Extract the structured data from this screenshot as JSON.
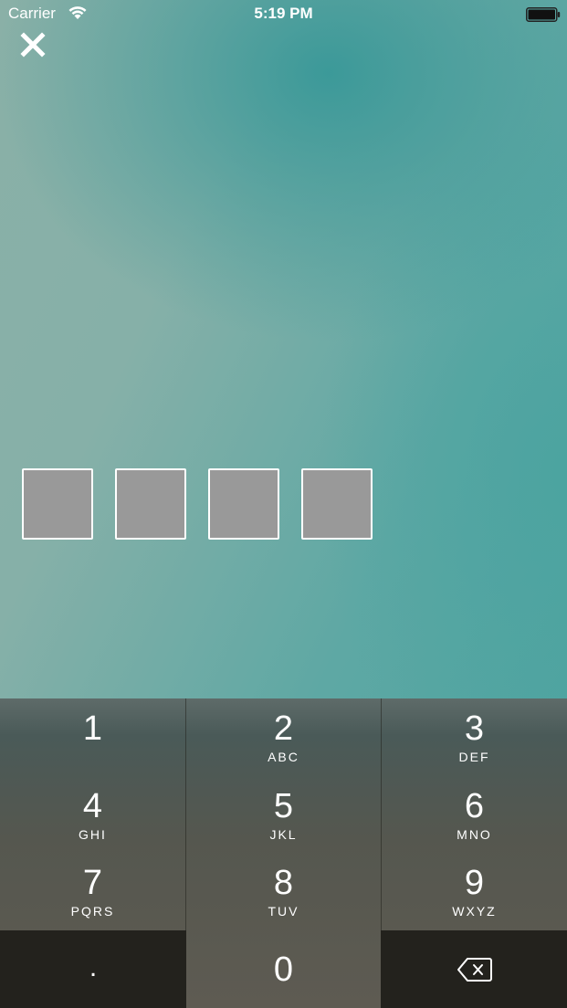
{
  "status_bar": {
    "carrier": "Carrier",
    "time": "5:19 PM",
    "wifi_icon": "wifi-icon",
    "battery_icon": "battery-icon"
  },
  "close_icon": "close-icon",
  "code_entry": {
    "boxes": [
      "",
      "",
      "",
      ""
    ],
    "box_fill_color": "#999999",
    "box_border_color": "#ffffff"
  },
  "keypad": {
    "keys": [
      {
        "digit": "1",
        "letters": ""
      },
      {
        "digit": "2",
        "letters": "ABC"
      },
      {
        "digit": "3",
        "letters": "DEF"
      },
      {
        "digit": "4",
        "letters": "GHI"
      },
      {
        "digit": "5",
        "letters": "JKL"
      },
      {
        "digit": "6",
        "letters": "MNO"
      },
      {
        "digit": "7",
        "letters": "PQRS"
      },
      {
        "digit": "8",
        "letters": "TUV"
      },
      {
        "digit": "9",
        "letters": "WXYZ"
      },
      {
        "digit": ".",
        "letters": ""
      },
      {
        "digit": "0",
        "letters": ""
      }
    ],
    "backspace_icon": "backspace-icon",
    "dark_key_color": "#23221d"
  }
}
